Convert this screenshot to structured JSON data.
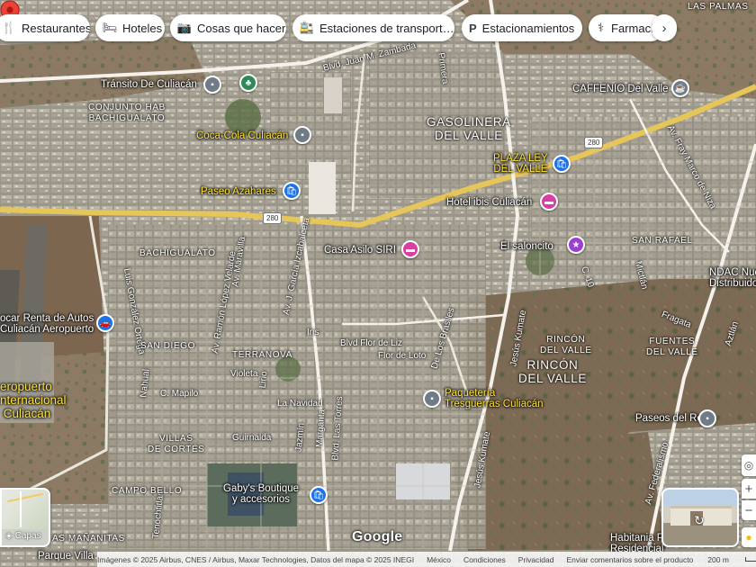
{
  "chips": [
    {
      "id": "restaurantes",
      "icon": "fork-knife-icon",
      "glyph": "🍴",
      "label": "Restaurantes"
    },
    {
      "id": "hoteles",
      "icon": "bed-icon",
      "glyph": "🛏",
      "label": "Hoteles"
    },
    {
      "id": "cosas",
      "icon": "camera-icon",
      "glyph": "📷",
      "label": "Cosas que hacer"
    },
    {
      "id": "transporte",
      "icon": "bus-icon",
      "glyph": "🚉",
      "label": "Estaciones de transport…"
    },
    {
      "id": "estacionamientos",
      "icon": "parking-icon",
      "glyph": "P",
      "label": "Estacionamientos"
    },
    {
      "id": "farmacias",
      "icon": "pharmacy-icon",
      "glyph": "⚕",
      "label": "Farmaci"
    }
  ],
  "chips_next": "›",
  "streets": {
    "juan_zambada": "Blvd. Juan M. Zambada",
    "primera": "Primera",
    "fray_marcos": "Av. Fray Marco de Niza",
    "maravilla": "Av. Maravilla",
    "ramon_lopez": "Av. Ramón López Velarde",
    "garcia_izcabalceta": "Av. J. García Izcabalceta",
    "gonzalez_ortega": "Luis González Ortega",
    "iris": "Iris",
    "flor_liz": "Blvd Flor de Liz",
    "flor_loto": "Flor de Loto",
    "los_brasiles": "De Los Brasiles",
    "jesus_kumate": "Jesús Kumate",
    "jesus_kumate_2": "Jesús Kumate",
    "las_torres": "Blvd. Las Torres",
    "violeta": "Violeta",
    "lirio": "Lirio",
    "la_navidad": "La Navidad",
    "nahual": "Nahual",
    "c_mapilo": "C. Mapilo",
    "jazmin": "Jazmín",
    "margarita": "Margarita",
    "guirnalda": "Guirnalda",
    "tenochtitlan": "Tenochtitlan",
    "fragata": "Fragata",
    "mictlan": "Mictlán",
    "c10": "C. 10",
    "federalismo": "Av. Federalismo",
    "aztlan": "Aztlán",
    "road_280_a": "280",
    "road_280_b": "280"
  },
  "areas": {
    "las_palmas": "LAS PALMAS",
    "conjunto_bachigualato": "CONJUNTO HAB\nBACHIGUALATO",
    "gasolinera_valle": "GASOLINERA\nDEL VALLE",
    "bachigualato": "BACHIGUALATO",
    "san_rafael": "SAN RAFAEL",
    "san_diego": "SAN DIEGO",
    "terranova": "TERRANOVA",
    "rincon_valle_small": "RINCÓN\nDEL VALLE",
    "rincon_valle": "RINCÓN\nDEL VALLE",
    "fuentes_valle": "FUENTES\nDEL VALLE",
    "villas_cortes": "VILLAS\nDE CORTÉS",
    "campo_bello": "CAMPO BELLO",
    "las_mananitas": "AS MAÑANITAS"
  },
  "pois": {
    "transito": "Tránsito De Culiacán",
    "caffenio": "CAFFENIO Del Valle",
    "coca_cola": "Coca-Cola Culiacán",
    "plaza_ley": "PLAZA LEY\nDEL VALLE",
    "paseo_azahares": "Paseo Azahares",
    "hotel_ibis": "Hotel ibis Culiacán",
    "casa_asilo": "Casa Asilo SIRI",
    "el_saloncito": "El saloncito",
    "ndac": "NDAC Nue\nDistribuidora d",
    "car_rental": "ocar Renta de Autos\nCuliacán Aeropuerto",
    "aeropuerto": "eropuerto\nnternacional\n Culiacán",
    "paqueteria": "Paquetería\nTresguerras Culiacán",
    "paseos_rey": "Paseos del Rey",
    "gabys": "Gaby's Boutique\ny accesorios",
    "habitania": "Habitania Priva\nResidencial",
    "parque_villa": "Parque Villa"
  },
  "layers_label": "Capas",
  "google_logo": "Google",
  "footer": {
    "imagery": "Imágenes © 2025 Airbus, CNES / Airbus, Maxar Technologies, Datos del mapa © 2025 INEGI",
    "country": "México",
    "terms": "Condiciones",
    "privacy": "Privacidad",
    "feedback": "Enviar comentarios sobre el producto",
    "scale": "200 m"
  }
}
